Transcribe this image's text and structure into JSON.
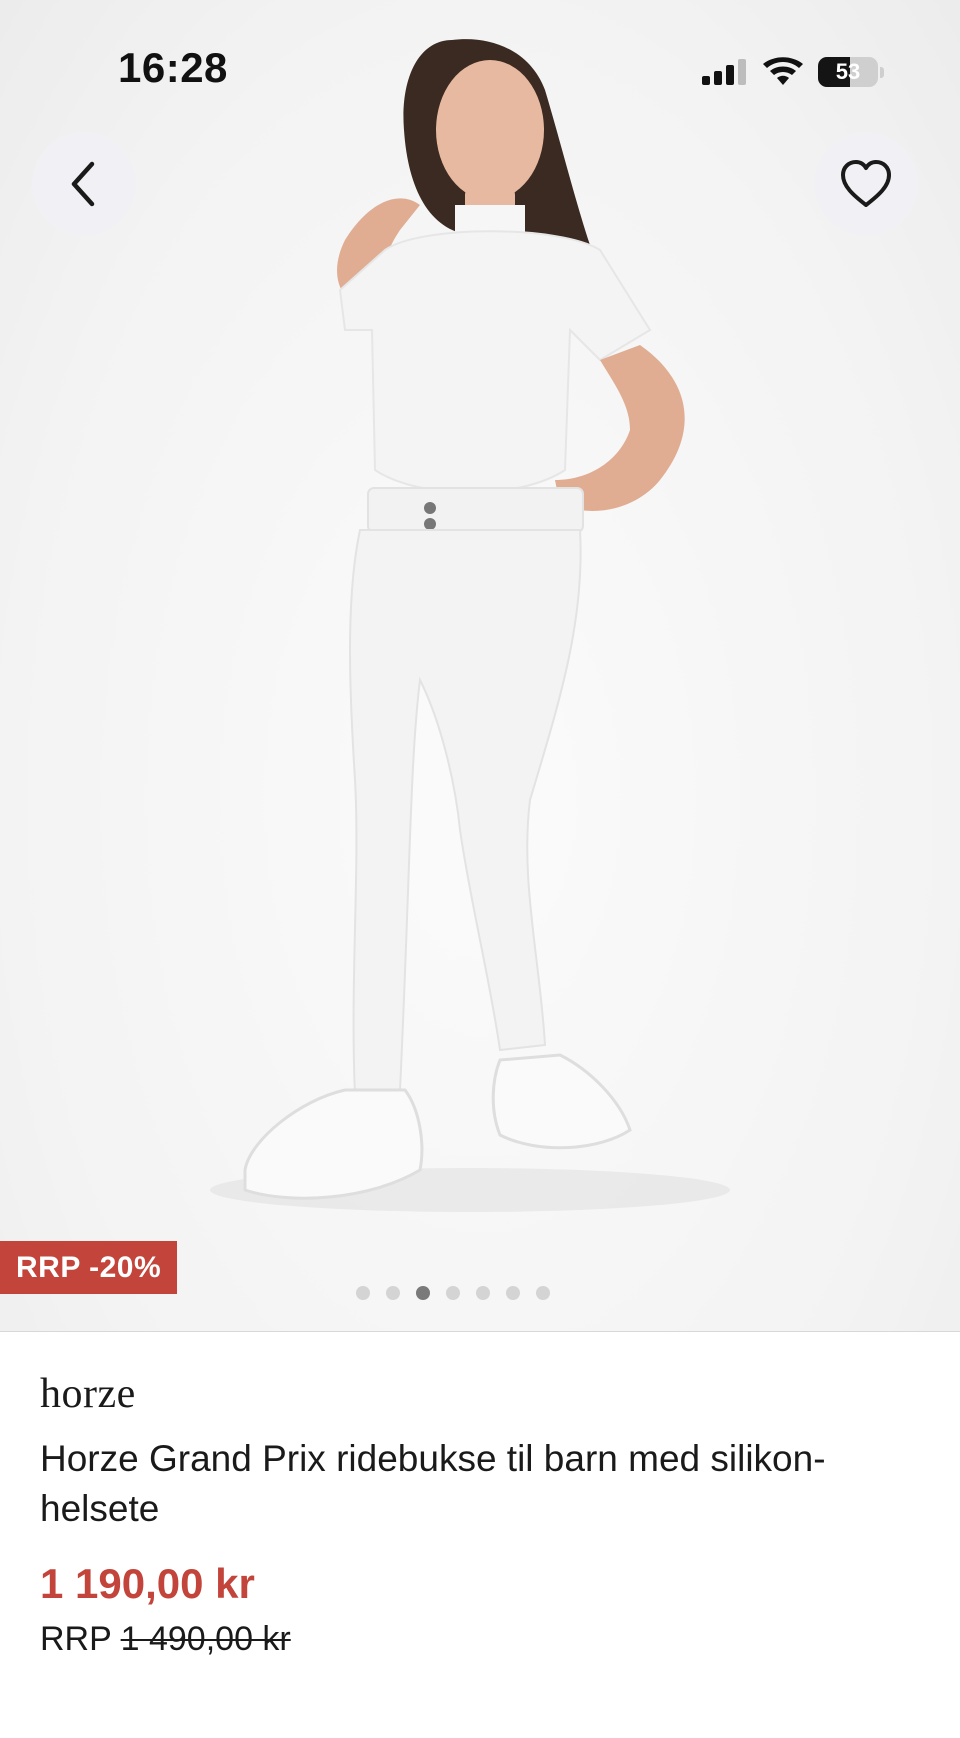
{
  "status_bar": {
    "time": "16:28",
    "battery_level": "53",
    "battery_fraction": 0.53,
    "icons": [
      "signal-icon",
      "wifi-icon",
      "battery-icon"
    ]
  },
  "navigation": {
    "back_icon": "chevron-left-icon",
    "favorite_icon": "heart-outline-icon"
  },
  "gallery": {
    "badge": "RRP -20%",
    "image_count": 7,
    "active_index": 2
  },
  "product": {
    "brand": "horze",
    "title": "Horze Grand Prix ridebukse til barn med silikon-helsete",
    "price": "1 190,00 kr",
    "rrp_label": "RRP",
    "rrp_price": "1 490,00 kr"
  },
  "colors": {
    "accent_red": "#c2443a",
    "button_bg": "#f1f0f4",
    "text": "#1a1a1a"
  }
}
